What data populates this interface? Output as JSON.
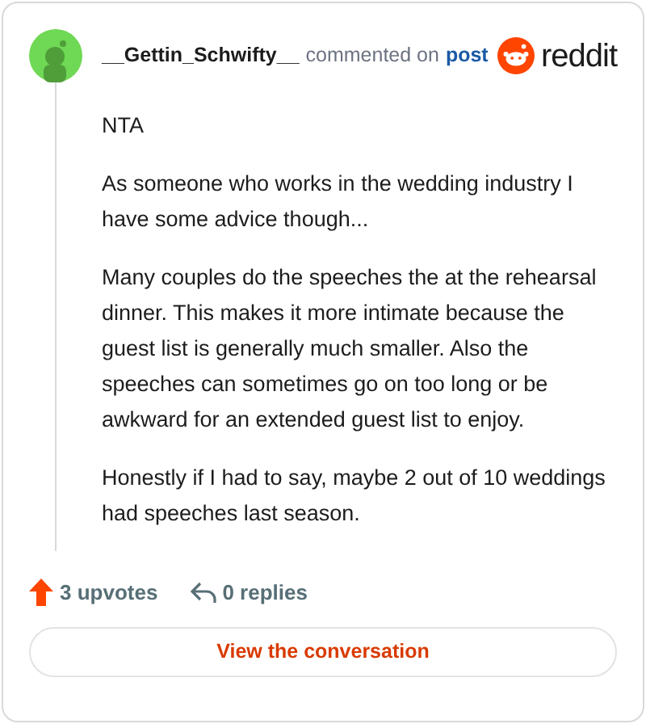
{
  "header": {
    "username": "__Gettin_Schwifty__",
    "action": "commented on",
    "link": "post",
    "brand": "reddit"
  },
  "comment": {
    "paragraphs": [
      "NTA",
      "As someone who works in the wedding industry I have some advice though...",
      "Many couples do the speeches the at the rehearsal dinner. This makes it more intimate because the guest list is generally much smaller. Also the speeches can sometimes go on too long or be awkward for an extended guest list to enjoy.",
      "Honestly if I had to say, maybe 2 out of 10 weddings had speeches last season."
    ]
  },
  "footer": {
    "upvotes": "3 upvotes",
    "replies": "0 replies"
  },
  "button": {
    "label": "View the conversation"
  }
}
